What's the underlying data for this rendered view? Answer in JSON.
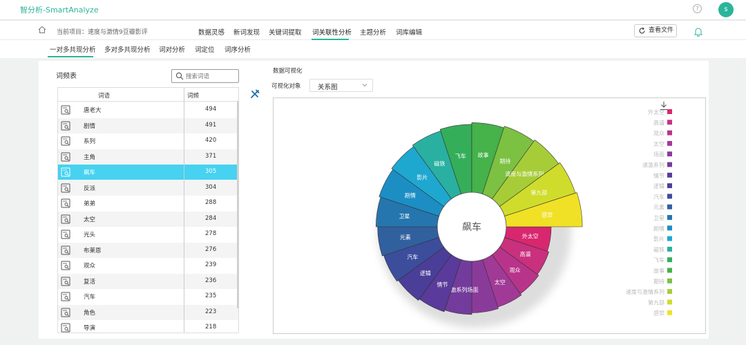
{
  "app": {
    "title": "智分析-SmartAnalyze",
    "avatar_letter": "s",
    "accent": "#2bb59a"
  },
  "nav": {
    "breadcrumb": "当前项目：速度与激情9豆瓣影评",
    "tabs": [
      "数据灵感",
      "新词发现",
      "关键词提取",
      "词关联性分析",
      "主题分析",
      "词库编辑"
    ],
    "active_tab": "词关联性分析",
    "view_file": "查看文件"
  },
  "subtabs": {
    "items": [
      "一对多共现分析",
      "多对多共现分析",
      "词对分析",
      "词定位",
      "词序分析"
    ],
    "active": "一对多共现分析"
  },
  "freq_table": {
    "title": "词频表",
    "search_placeholder": "搜索词语",
    "headers": {
      "word": "词语",
      "freq": "词频"
    },
    "rows": [
      {
        "word": "唐老大",
        "freq": "494"
      },
      {
        "word": "剧情",
        "freq": "491"
      },
      {
        "word": "系列",
        "freq": "420"
      },
      {
        "word": "主角",
        "freq": "371"
      },
      {
        "word": "飙车",
        "freq": "305"
      },
      {
        "word": "反派",
        "freq": "304"
      },
      {
        "word": "弟弟",
        "freq": "288"
      },
      {
        "word": "太空",
        "freq": "284"
      },
      {
        "word": "光头",
        "freq": "278"
      },
      {
        "word": "布莱恩",
        "freq": "276"
      },
      {
        "word": "观众",
        "freq": "239"
      },
      {
        "word": "复活",
        "freq": "236"
      },
      {
        "word": "汽车",
        "freq": "235"
      },
      {
        "word": "角色",
        "freq": "223"
      },
      {
        "word": "导演",
        "freq": "218"
      }
    ],
    "selected_index": 4,
    "highlight_color": "#46d2f0"
  },
  "viz": {
    "title": "数据可视化",
    "object_label": "可视化对象",
    "object_value": "关系图",
    "center_word": "飙车"
  },
  "chart_data": {
    "type": "pie",
    "variant": "radial-rose",
    "center_label": "飙车",
    "legend_position": "right",
    "categories": [
      "外太空",
      "高谱",
      "观众",
      "太空",
      "场面",
      "速激系列",
      "情节",
      "逻辑",
      "汽车",
      "元素",
      "卫星",
      "剧情",
      "影片",
      "磁铁",
      "飞车",
      "故事",
      "期待",
      "速度与激情系列",
      "第九部",
      "感觉"
    ],
    "legend_labels": [
      "外太空",
      "高谱",
      "观众",
      "太空",
      "场面",
      "速激系列",
      "情节",
      "逻辑",
      "汽车",
      "元素",
      "卫星",
      "剧情",
      "影片",
      "磁铁",
      "飞车",
      "故事",
      "期待",
      "速度与激情系列",
      "第九部",
      "感觉"
    ],
    "slice_labels": [
      "外太空",
      "高谱",
      "观众",
      "太空",
      "",
      "速激系列场面",
      "情节",
      "逻辑",
      "汽车",
      "元素",
      "卫星",
      "剧情",
      "影片",
      "磁铁",
      "飞车",
      "故事",
      "期待",
      "速度与激情系列",
      "第九部",
      "感觉"
    ],
    "values": [
      40,
      42,
      44,
      46,
      48,
      50,
      52,
      54,
      56,
      58,
      60,
      62,
      64,
      66,
      68,
      70,
      72,
      74,
      76,
      78
    ],
    "colors": [
      "#d8276e",
      "#c9307e",
      "#b8348b",
      "#a03a96",
      "#8a3b9a",
      "#733c9c",
      "#5a3a9a",
      "#4a3e98",
      "#3c4d9c",
      "#31609f",
      "#2576ae",
      "#1c8ec4",
      "#1ea8cf",
      "#2ab0a0",
      "#35ae5a",
      "#45b24a",
      "#7cc142",
      "#a6cd38",
      "#d0dc2b",
      "#f0e126"
    ]
  }
}
